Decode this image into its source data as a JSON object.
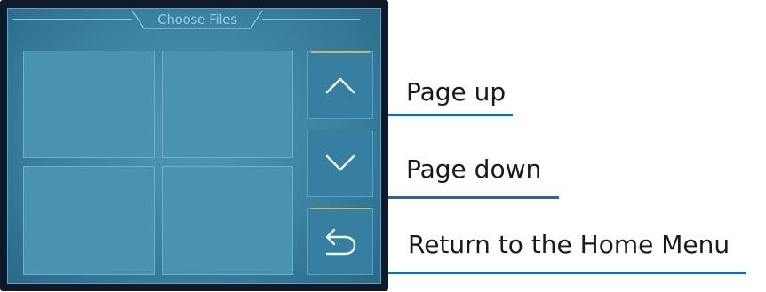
{
  "dialog": {
    "title": "Choose Files"
  },
  "file_slots": [
    {
      "id": "slot-1"
    },
    {
      "id": "slot-2"
    },
    {
      "id": "slot-3"
    },
    {
      "id": "slot-4"
    }
  ],
  "nav_buttons": {
    "page_up_icon": "chevron-up-icon",
    "page_down_icon": "chevron-down-icon",
    "return_icon": "return-arrow-icon"
  },
  "callouts": {
    "page_up": "Page up",
    "page_down": "Page down",
    "return_home": "Return to the Home Menu"
  },
  "colors": {
    "screen_bg": "#3a82a0",
    "title_text": "#8fd0e8",
    "callout_underline": "#1a6ab0",
    "button_accent": "#c9b870"
  }
}
